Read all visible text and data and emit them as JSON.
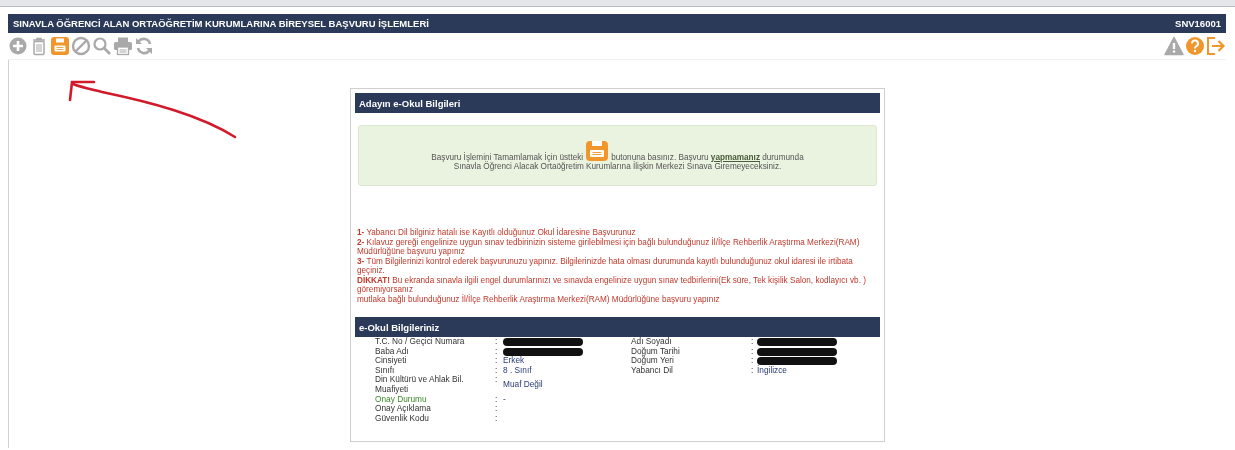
{
  "header": {
    "title": "SINAVLA ÖĞRENCİ ALAN ORTAÖĞRETİM KURUMLARINA BİREYSEL BAŞVURU İŞLEMLERİ",
    "code": "SNV16001"
  },
  "toolbar": {
    "left": [
      {
        "kind": "add",
        "active": false
      },
      {
        "kind": "delete",
        "active": false
      },
      {
        "kind": "save",
        "active": true
      },
      {
        "kind": "cancel",
        "active": false
      },
      {
        "kind": "search",
        "active": false
      },
      {
        "kind": "print",
        "active": false
      },
      {
        "kind": "refresh",
        "active": false
      }
    ],
    "right": [
      {
        "kind": "warning",
        "active": false
      },
      {
        "kind": "help",
        "active": true
      },
      {
        "kind": "exit",
        "active": true
      }
    ]
  },
  "annotation": {
    "kind": "arrow"
  },
  "card": {
    "title": "Adayın e-Okul Bilgileri",
    "notice": {
      "before_icon": "Başvuru İşlemini Tamamlamak İçin üstteki",
      "after_icon": "butonuna basınız. Başvuru **yapmamanız** durumunda",
      "second_line": "Sınavla Öğrenci Alacak Ortaöğretim Kurumlarına İlişkin Merkezi Sınava Giremeyeceksiniz."
    },
    "warnings": [
      "**1-** Yabancı Dil bilginiz hatalı ise Kayıtlı olduğunuz Okul İdaresine Başvurunuz",
      "**2-** Kılavuz gereği engelinize uygun sınav tedbirinizin sisteme girilebilmesi için bağlı bulunduğunuz İl/İlçe Rehberlik Araştırma Merkezi(RAM) Müdürlüğüne başvuru yapınız",
      "**3-** Tüm Bilgilerinizi kontrol ederek başvurunuzu yapınız. Bilgilerinizde hata olması durumunda kayıtlı bulunduğunuz okul idaresi ile irtibata geçiniz.",
      "**DİKKAT!** Bu ekranda sınavla ilgili engel durumlarınızı ve sınavda engelinize uygun sınav tedbirlerini(Ek süre, Tek kişilik Salon, kodlayıcı vb. ) göremiyorsanız",
      "mutlaka bağlı bulunduğunuz İl/İlçe Rehberlik Araştırma Merkezi(RAM) Müdürlüğüne başvuru yapınız"
    ],
    "info": {
      "title": "e-Okul Bilgileriniz",
      "rows": [
        {
          "left": {
            "label": "T.C. No / Geçici Numara",
            "separator": ":",
            "redacted": true,
            "emphasis": false
          },
          "right": {
            "label": "Adı Soyadı",
            "separator": ":",
            "redacted": true,
            "emphasis": false
          }
        },
        {
          "left": {
            "label": "Baba Adı",
            "separator": ":",
            "redacted": true,
            "emphasis": false
          },
          "right": {
            "label": "Doğum Tarihi",
            "separator": ":",
            "redacted": true,
            "emphasis": false
          }
        },
        {
          "left": {
            "label": "Cinsiyeti",
            "separator": ":",
            "value": "Erkek",
            "emphasis": false
          },
          "right": {
            "label": "Doğum Yeri",
            "separator": ":",
            "redacted": true,
            "emphasis": false
          }
        },
        {
          "left": {
            "label": "Sınıfı",
            "separator": ":",
            "value": "8 . Sınıf",
            "emphasis": false
          },
          "right": {
            "label": "Yabancı Dil",
            "separator": ":",
            "value": "İngilizce",
            "emphasis": false
          }
        },
        {
          "left": {
            "label": "Din Kültürü ve Ahlak Bil. Muafiyeti",
            "separator": ":",
            "value": "Muaf Değil",
            "emphasis": false
          }
        },
        {
          "left": {
            "label": "Onay Durumu",
            "separator": ":",
            "value": "-",
            "emphasis": true
          }
        },
        {
          "left": {
            "label": "Onay Açıklama",
            "separator": ":",
            "emphasis": false
          }
        },
        {
          "left": {
            "label": "Güvenlik Kodu",
            "separator": ":",
            "emphasis": false
          }
        }
      ]
    }
  }
}
